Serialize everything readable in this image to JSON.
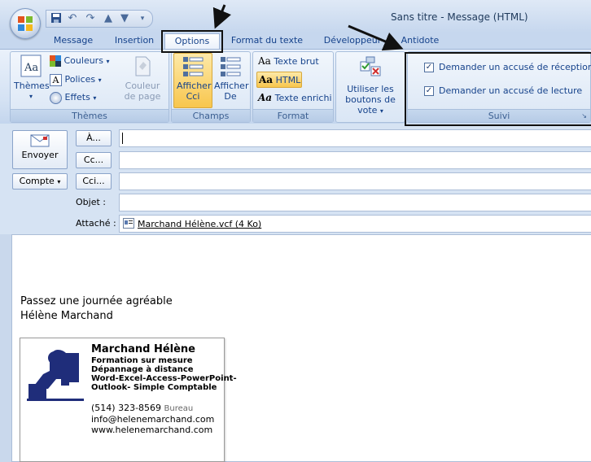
{
  "window": {
    "title": "Sans titre - Message (HTML)"
  },
  "tabs": [
    {
      "label": "Message"
    },
    {
      "label": "Insertion"
    },
    {
      "label": "Options"
    },
    {
      "label": "Format du texte"
    },
    {
      "label": "Développeur"
    },
    {
      "label": "Antidote"
    }
  ],
  "ribbon": {
    "themes": {
      "themes_label": "Thèmes",
      "couleurs_label": "Couleurs",
      "polices_label": "Polices",
      "effets_label": "Effets",
      "couleur_page_label": "Couleur de page",
      "group_label": "Thèmes"
    },
    "champs": {
      "afficher_cci_label": "Afficher Cci",
      "afficher_de_label": "Afficher De",
      "group_label": "Champs"
    },
    "format": {
      "texte_brut_label": "Texte brut",
      "html_label": "HTML",
      "texte_enrichi_label": "Texte enrichi",
      "group_label": "Format"
    },
    "vote": {
      "label": "Utiliser les boutons de vote"
    },
    "suivi": {
      "accuse_reception_label": "Demander un accusé de réception",
      "accuse_lecture_label": "Demander un accusé de lecture",
      "group_label": "Suivi"
    }
  },
  "compose": {
    "envoyer_label": "Envoyer",
    "compte_label": "Compte",
    "a_label": "À...",
    "cc_label": "Cc...",
    "cci_label": "Cci...",
    "objet_label": "Objet :",
    "attache_label": "Attaché :",
    "attachment": "Marchand Hélène.vcf (4 Ko)"
  },
  "body": {
    "line1": "Passez une journée agréable",
    "line2": "Hélène Marchand"
  },
  "card": {
    "name": "Marchand Hélène",
    "l1": "Formation sur mesure",
    "l2": "Dépannage à distance",
    "l3": "Word-Excel-Access-PowerPoint-",
    "l4": "Outlook- Simple Comptable",
    "phone": "(514) 323-8569",
    "phone_type": "Bureau",
    "email": "info@helenemarchand.com",
    "web": "www.helenemarchand.com"
  },
  "colors": {
    "accent": "#15428b",
    "ribbon_bg": "#dae6f5",
    "highlight": "#f9c64a"
  }
}
